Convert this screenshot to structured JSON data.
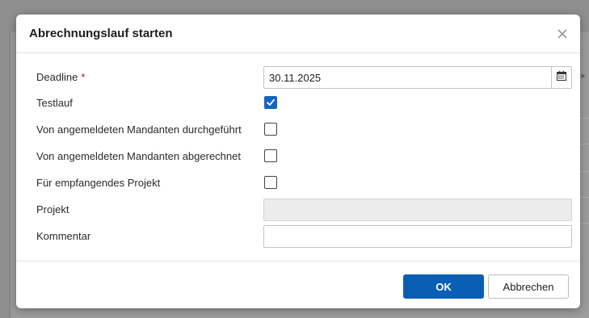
{
  "dialog": {
    "title": "Abrechnungslauf starten"
  },
  "form": {
    "deadline": {
      "label": "Deadline",
      "required_marker": "*",
      "value": "30.11.2025"
    },
    "testlauf": {
      "label": "Testlauf",
      "checked": true
    },
    "durchgefuehrt": {
      "label": "Von angemeldeten Mandanten durchgeführt",
      "checked": false
    },
    "abgerechnet": {
      "label": "Von angemeldeten Mandanten abgerechnet",
      "checked": false
    },
    "empfangendes_projekt": {
      "label": "Für empfangendes Projekt",
      "checked": false
    },
    "projekt": {
      "label": "Projekt",
      "value": "",
      "disabled": true
    },
    "kommentar": {
      "label": "Kommentar",
      "value": ""
    }
  },
  "footer": {
    "ok_label": "OK",
    "cancel_label": "Abbrechen"
  },
  "colors": {
    "primary": "#0a5fb4",
    "required": "#d0021b",
    "checkbox_checked": "#1565c0"
  },
  "icons": {
    "close": "close-icon",
    "calendar": "calendar-icon",
    "check": "checkmark-icon",
    "background_chevron": "chevron-down-double-icon"
  }
}
